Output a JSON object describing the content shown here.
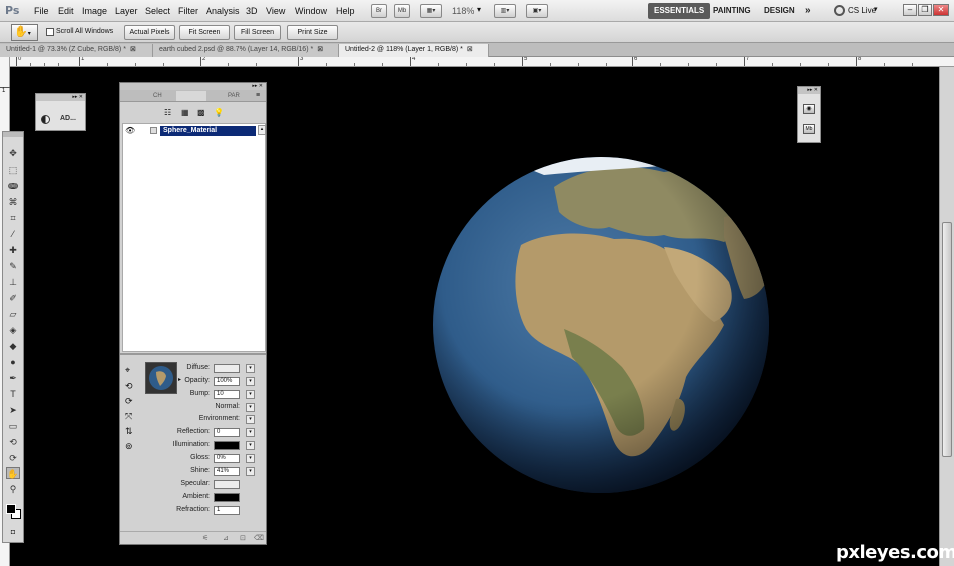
{
  "app": {
    "logo": "Ps"
  },
  "menu": [
    "File",
    "Edit",
    "Image",
    "Layer",
    "Select",
    "Filter",
    "Analysis",
    "3D",
    "View",
    "Window",
    "Help"
  ],
  "menubar_icons": {
    "bridge": "Br",
    "minibridge": "Mb"
  },
  "zoom": "118%",
  "workspaces": {
    "essentials": "ESSENTIALS",
    "painting": "PAINTING",
    "design": "DESIGN",
    "more": "»",
    "cs_live": "CS Live"
  },
  "options": {
    "scroll_all_windows": "Scroll All Windows",
    "scroll_all_checked": false,
    "buttons": [
      "Actual Pixels",
      "Fit Screen",
      "Fill Screen",
      "Print Size"
    ]
  },
  "tabs": [
    {
      "label": "Untitled-1 @ 73.3% (Z Cube, RGB/8) *",
      "active": false
    },
    {
      "label": "earth cubed 2.psd @ 88.7% (Layer 14, RGB/16) *",
      "active": false
    },
    {
      "label": "Untitled-2 @ 118% (Layer 1, RGB/8) *",
      "active": true
    }
  ],
  "ruler": {
    "labels": [
      "0",
      "1",
      "2",
      "3",
      "4",
      "5",
      "6",
      "7",
      "8"
    ],
    "vlabel": "1"
  },
  "adjustments_panel": {
    "label": "AD..."
  },
  "panel_3d": {
    "tabs": [
      "CH",
      "3D",
      "PAR"
    ],
    "material_name": "Sphere_Material",
    "properties": [
      {
        "label": "Diffuse:",
        "value": "",
        "kind": "blank"
      },
      {
        "label": "Opacity:",
        "value": "100%",
        "kind": "text"
      },
      {
        "label": "Bump:",
        "value": "10",
        "kind": "text"
      },
      {
        "label": "Normal:",
        "value": "",
        "kind": "none"
      },
      {
        "label": "Environment:",
        "value": "",
        "kind": "none"
      },
      {
        "label": "Reflection:",
        "value": "0",
        "kind": "text"
      },
      {
        "label": "Illumination:",
        "value": "",
        "kind": "black"
      },
      {
        "label": "Gloss:",
        "value": "0%",
        "kind": "text"
      },
      {
        "label": "Shine:",
        "value": "41%",
        "kind": "text"
      },
      {
        "label": "Specular:",
        "value": "",
        "kind": "blank"
      },
      {
        "label": "Ambient:",
        "value": "",
        "kind": "black"
      },
      {
        "label": "Refraction:",
        "value": "1",
        "kind": "text"
      }
    ]
  },
  "right_panel": {
    "mb_label": "Mb"
  },
  "watermark": "pxleyes.com",
  "colors": {
    "canvas": "#000000",
    "selection": "#0c2a76",
    "ocean": "#2f5c8a",
    "land": "#b49a6a"
  }
}
